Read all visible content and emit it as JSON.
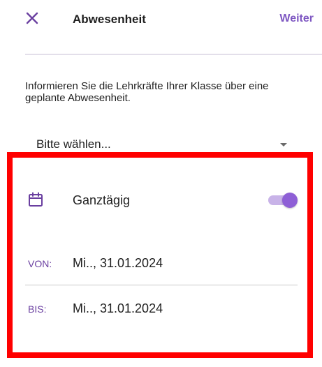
{
  "header": {
    "close_icon": "close-icon",
    "title": "Abwesenheit",
    "next_label": "Weiter"
  },
  "intro_text": "Informieren Sie die Lehrkräfte Ihrer Klasse über eine geplante Abwesenheit.",
  "reason_select": {
    "value": "Bitte wählen...",
    "caret_icon": "caret-down-icon"
  },
  "all_day": {
    "icon": "calendar-icon",
    "label": "Ganztägig",
    "enabled": true
  },
  "from": {
    "label": "VON:",
    "value": "Mi.., 31.01.2024"
  },
  "to": {
    "label": "BIS:",
    "value": "Mi.., 31.01.2024"
  },
  "colors": {
    "accent": "#7e57c2",
    "toggle_track": "#c8b3e8",
    "toggle_thumb": "#8e5fd6",
    "date_label": "#6a3fa0",
    "highlight": "#ff0000"
  }
}
